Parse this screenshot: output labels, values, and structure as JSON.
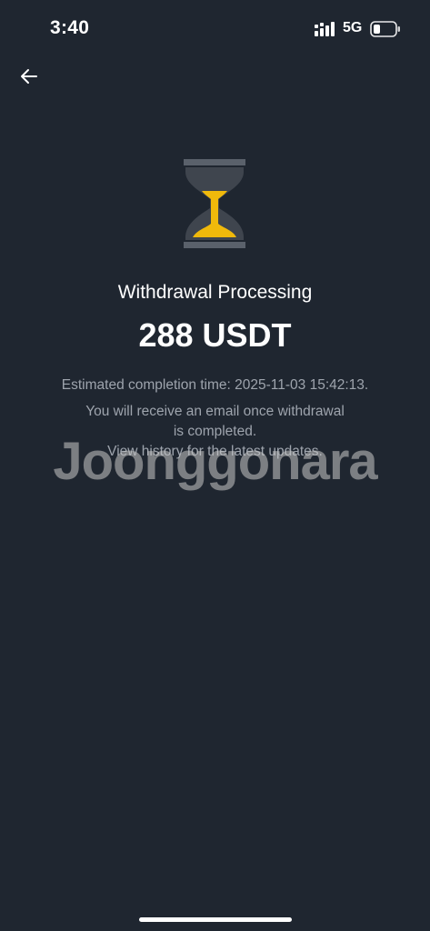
{
  "status_bar": {
    "time": "3:40",
    "network": "5G",
    "signal_icon": "cellular-signal-icon",
    "battery_icon": "battery-icon"
  },
  "header": {
    "back_icon": "arrow-left-icon"
  },
  "main": {
    "icon": "hourglass-icon",
    "title": "Withdrawal Processing",
    "amount": "288 USDT",
    "eta": "Estimated completion time: 2025-11-03 15:42:13.",
    "note_lines": [
      "You will receive an email once withdrawal",
      "is completed.",
      "View history for the latest updates."
    ]
  },
  "watermark": "Joonggonara",
  "colors": {
    "background": "#1f2630",
    "accent": "#f0b90b",
    "secondary_text": "#9ea4ad"
  }
}
